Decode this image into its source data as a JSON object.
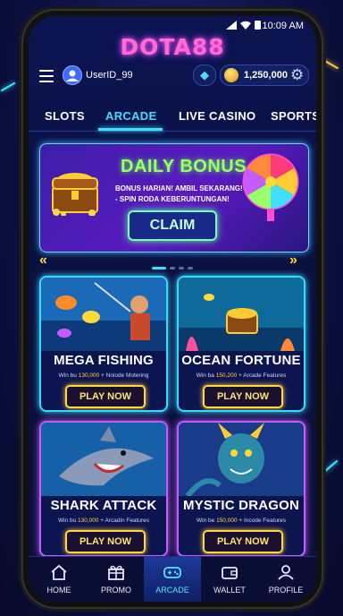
{
  "status": {
    "time": "10:09 AM"
  },
  "logo": "DOTA88",
  "header": {
    "user_id": "UserID_99",
    "balance": "1,250,000"
  },
  "tabs": [
    {
      "label": "SLOTS",
      "active": false
    },
    {
      "label": "ARCADE",
      "active": true
    },
    {
      "label": "LIVE CASINO",
      "active": false
    },
    {
      "label": "SPORTS",
      "active": false
    }
  ],
  "banner": {
    "title": "DAILY BONUS",
    "line1": "BONUS HARIAN! AMBIL SEKARANG!",
    "line2": "- SPIN RODA KEBERUNTUNGAN!",
    "button": "CLAIM"
  },
  "games": [
    {
      "title": "MEGA FISHING",
      "desc_prefix": "Win bu ",
      "desc_amount": "130,000",
      "desc_suffix": " + Noiode Motering",
      "button": "PLAY NOW"
    },
    {
      "title": "OCEAN FORTUNE",
      "desc_prefix": "Win ba ",
      "desc_amount": "150,200",
      "desc_suffix": " + Arcade Features",
      "button": "PLAY NOW"
    },
    {
      "title": "SHARK ATTACK",
      "desc_prefix": "Win bu ",
      "desc_amount": "130,000",
      "desc_suffix": " + Arcadin Features",
      "button": "PLAY NOW"
    },
    {
      "title": "MYSTIC DRAGON",
      "desc_prefix": "Win be ",
      "desc_amount": "150,000",
      "desc_suffix": " + Incode Features",
      "button": "PLAY NOW"
    }
  ],
  "nav": [
    {
      "label": "HOME",
      "icon": "home-icon"
    },
    {
      "label": "PROMO",
      "icon": "gift-icon"
    },
    {
      "label": "ARCADE",
      "icon": "gamepad-icon",
      "active": true
    },
    {
      "label": "WALLET",
      "icon": "wallet-icon"
    },
    {
      "label": "PROFILE",
      "icon": "user-icon"
    }
  ],
  "colors": {
    "accent": "#3fe0ff",
    "brand": "#ff6ad5",
    "button": "#ffd83a",
    "bonus": "#9aff6a"
  }
}
